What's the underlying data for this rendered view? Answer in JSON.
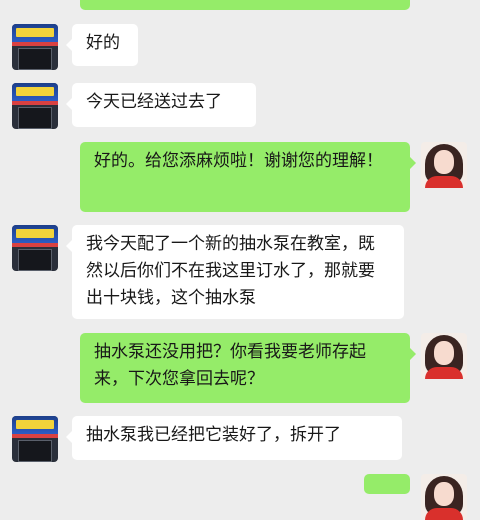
{
  "messages": [
    {
      "side": "left",
      "text": "好的"
    },
    {
      "side": "left",
      "text": "今天已经送过去了"
    },
    {
      "side": "right",
      "text": "好的。给您添麻烦啦！谢谢您的理解！"
    },
    {
      "side": "left",
      "text": "我今天配了一个新的抽水泵在教室，既然以后你们不在我这里订水了，那就要出十块钱，这个抽水泵"
    },
    {
      "side": "right",
      "text": "抽水泵还没用把？你看我要老师存起来，下次您拿回去呢？"
    },
    {
      "side": "left",
      "text": "抽水泵我已经把它装好了，拆开了"
    }
  ],
  "colors": {
    "background": "#ededed",
    "sent_bubble": "#95ec69",
    "received_bubble": "#ffffff"
  }
}
